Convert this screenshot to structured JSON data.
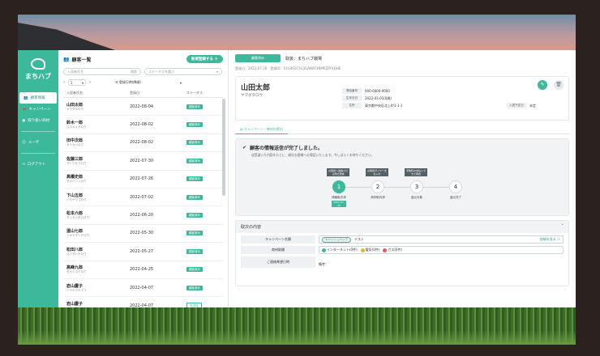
{
  "sidebar": {
    "app_name": "まちハブ",
    "items": [
      {
        "label": "顧客情報",
        "icon": "people-icon"
      },
      {
        "label": "キャンペーン",
        "icon": "megaphone-icon"
      },
      {
        "label": "取り扱い商材",
        "icon": "box-icon"
      },
      {
        "label": "ユーザ",
        "icon": "user-icon"
      },
      {
        "label": "ログアウト",
        "icon": "logout-icon"
      }
    ]
  },
  "list": {
    "title": "顧客一覧",
    "new_button": "新規登録する ＋",
    "search_placeholder": "入居者氏名",
    "search_button": "検索",
    "status_placeholder": "ステータスを選ぶ",
    "page": "1",
    "sort_label": "登録日時(降順)",
    "columns": [
      "入居者氏名",
      "登録日",
      "ステータス"
    ],
    "rows": [
      {
        "name": "山田太郎",
        "kana": "ヤマダタロウ",
        "date": "2022-08-04",
        "status": "顧客済み"
      },
      {
        "name": "鈴木一郎",
        "kana": "スズキイチロウ",
        "date": "2022-08-02",
        "status": "顧客済み"
      },
      {
        "name": "田中次郎",
        "kana": "タナカジロウ",
        "date": "2022-08-02",
        "status": "顧客済み"
      },
      {
        "name": "佐藤三郎",
        "kana": "サトウサブロウ",
        "date": "2022-07-30",
        "status": "顧客済み"
      },
      {
        "name": "高橋史郎",
        "kana": "タカハシシロウ",
        "date": "2022-07-26",
        "status": "顧客済み"
      },
      {
        "name": "下山五郎",
        "kana": "シモヤマゴロウ",
        "date": "2022-07-02",
        "status": "顧客済み"
      },
      {
        "name": "松本六郎",
        "kana": "マツモトロクロウ",
        "date": "2022-06-20",
        "status": "顧客済み"
      },
      {
        "name": "遠山七郎",
        "kana": "トオヤマシチロウ",
        "date": "2022-05-30",
        "status": "顧客済み"
      },
      {
        "name": "松田八郎",
        "kana": "マツダハチロウ",
        "date": "2022-05-27",
        "status": "顧客済み"
      },
      {
        "name": "高峰九郎",
        "kana": "タカミネクロウ",
        "date": "2022-04-25",
        "status": "顧客済み"
      },
      {
        "name": "岩山慶子",
        "kana": "イワヤマケイコ",
        "date": "2022-04-07",
        "status": "顧客済み"
      },
      {
        "name": "岩山慶子",
        "kana": "イワヤマケイコ",
        "date": "2022-04-07",
        "status": "未送信",
        "outlined": true
      }
    ]
  },
  "detail": {
    "status_pill": "顧客済み",
    "shop": "取扱：まちハブ戦場",
    "meta": "登録日：2022-07-30　登録ID：01G9S1CYG3GAN0F3NMRZPY4DHE",
    "name": "山田太郎",
    "kana": "ヤマダタロウ",
    "info": [
      {
        "label": "電話番号",
        "value": "000-0000-0000"
      },
      {
        "label": "生年月日",
        "value": "2022-01-01(0歳)"
      },
      {
        "label": "住所",
        "value": "東京都中央区北上町1-1-1"
      }
    ],
    "move_label": "入居予定日",
    "move_value": "未定",
    "tab": "キャンペーン・商材の提出",
    "progress_title": "顧客の情報送信が完了しました。",
    "progress_sub": "送受渡いた内容をもとに、順次お客様へお電話いたします。今しばらくお待ちください。",
    "steps": [
      {
        "num": "1",
        "label": "情報取次済",
        "date": "2022-07-30",
        "tip": "お客様へ連絡させる際の送信"
      },
      {
        "num": "2",
        "label": "商材取内済",
        "tip": "お客様ダイヤーをお入れ"
      },
      {
        "num": "3",
        "label": "還元対象",
        "tip": "手数料お支払いできた場合"
      },
      {
        "num": "4",
        "label": "還元完了"
      }
    ],
    "section_title": "取次の内容",
    "campaign_label": "キャンペーン名類",
    "campaign_chip": "キャッシュバック",
    "campaign_value": "テスト",
    "campaign_link": "詳細を見る ＞",
    "product_label": "商材取類",
    "products": [
      "インターネット(0件)",
      "電気(0件)",
      "ガス(0件)"
    ],
    "product_colors": [
      "#3cb89a",
      "#f0b429",
      "#e05d5d"
    ],
    "contact_label": "ご連絡希望日時",
    "contact_value": "備考："
  }
}
